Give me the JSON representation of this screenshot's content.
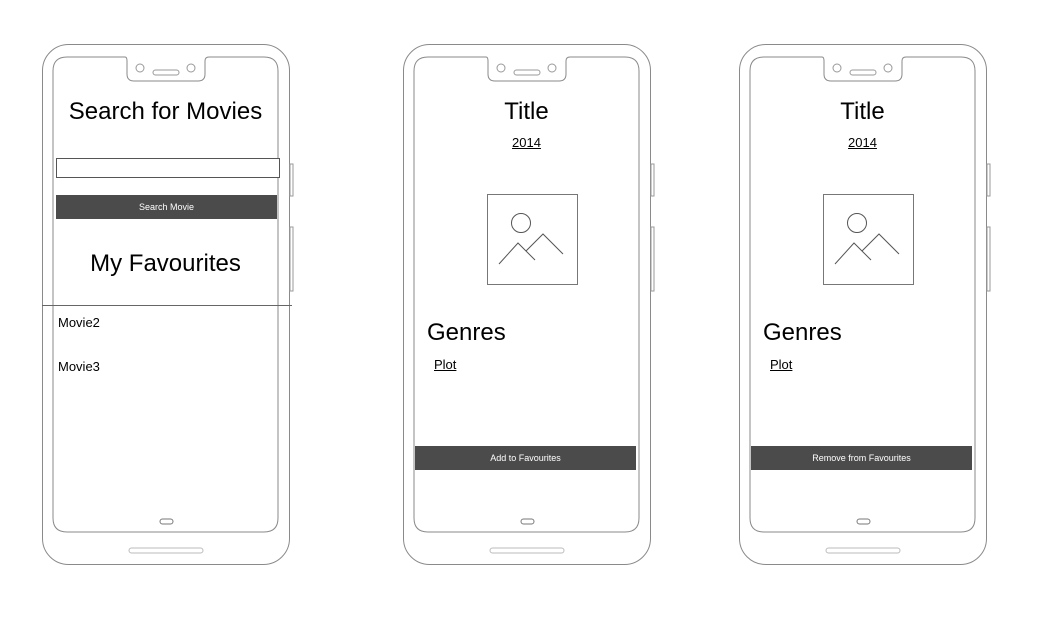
{
  "screen1": {
    "title": "Search for Movies",
    "search_input_value": "",
    "search_button_label": "Search Movie",
    "favourites_title": "My Favourites",
    "favourites": [
      "Movie2",
      "Movie3"
    ]
  },
  "screen2": {
    "title": "Title",
    "year": "2014",
    "image_icon": "image-placeholder-icon",
    "genres_label": "Genres",
    "plot_label": "Plot",
    "action_button_label": "Add to Favourites"
  },
  "screen3": {
    "title": "Title",
    "year": "2014",
    "image_icon": "image-placeholder-icon",
    "genres_label": "Genres",
    "plot_label": "Plot",
    "action_button_label": "Remove from Favourites"
  },
  "colors": {
    "button_bg": "#4b4b4b",
    "button_text": "#ffffff",
    "outline": "#888888"
  }
}
